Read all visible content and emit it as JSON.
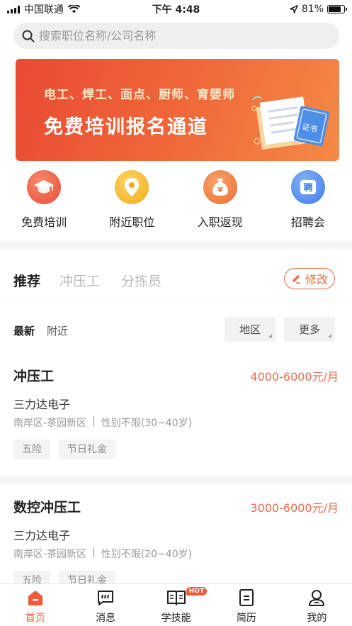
{
  "status_bar": {
    "carrier": "中国联通",
    "time": "下午 4:48",
    "battery": "81%",
    "battery_level": 0.81
  },
  "search": {
    "placeholder": "搜索职位名称/公司名称",
    "icon": "search-icon"
  },
  "banner": {
    "line1": "电工、焊工、面点、厨师、育婴师",
    "line2": "免费培训报名通道",
    "stamp": "证书"
  },
  "quick_entries": [
    {
      "label": "免费培训",
      "icon": "graduation-cap-icon",
      "color": "#ef5a43"
    },
    {
      "label": "附近职位",
      "icon": "location-pin-icon",
      "color": "#f4b72c"
    },
    {
      "label": "入职返现",
      "icon": "money-bag-icon",
      "color": "#f27a3b"
    },
    {
      "label": "招聘会",
      "icon": "recruit-icon",
      "color": "#4e8df0"
    }
  ],
  "job_tabs": {
    "items": [
      "推荐",
      "冲压工",
      "分拣员"
    ],
    "active": 0,
    "edit_label": "修改"
  },
  "filters": {
    "sort": [
      "最新",
      "附近"
    ],
    "region": "地区",
    "more": "更多"
  },
  "jobs": [
    {
      "title": "冲压工",
      "salary": "4000-6000元/月",
      "company": "三力达电子",
      "location": "南岸区-茶园新区",
      "requirement": "性别不限(30~40岁)",
      "tags": [
        "五险",
        "节日礼金"
      ]
    },
    {
      "title": "数控冲压工",
      "salary": "3000-6000元/月",
      "company": "三力达电子",
      "location": "南岸区-茶园新区",
      "requirement": "性别不限(20~40岁)",
      "tags": [
        "五险",
        "节日礼金"
      ]
    }
  ],
  "tab_bar": {
    "items": [
      {
        "label": "首页",
        "icon": "home-icon"
      },
      {
        "label": "消息",
        "icon": "message-icon"
      },
      {
        "label": "学技能",
        "icon": "book-icon"
      },
      {
        "label": "简历",
        "icon": "resume-icon"
      },
      {
        "label": "我的",
        "icon": "profile-icon"
      }
    ],
    "active": 0,
    "hot_badge": "HOT",
    "accent": "#ee5a3c"
  },
  "colors": {
    "accent": "#ee6a4c",
    "banner_gradient": [
      "#e94a33",
      "#f48a45"
    ]
  }
}
